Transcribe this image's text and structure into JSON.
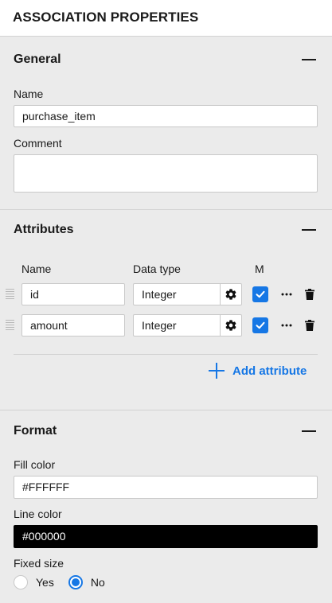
{
  "header": {
    "title": "ASSOCIATION PROPERTIES"
  },
  "general": {
    "title": "General",
    "name_label": "Name",
    "name_value": "purchase_item",
    "comment_label": "Comment",
    "comment_value": ""
  },
  "attributes": {
    "title": "Attributes",
    "columns": {
      "name": "Name",
      "data_type": "Data type",
      "mandatory": "M"
    },
    "rows": [
      {
        "name": "id",
        "data_type": "Integer",
        "mandatory": true
      },
      {
        "name": "amount",
        "data_type": "Integer",
        "mandatory": true
      }
    ],
    "add_label": "Add attribute"
  },
  "format": {
    "title": "Format",
    "fill_label": "Fill color",
    "fill_value": "#FFFFFF",
    "line_label": "Line color",
    "line_value": "#000000",
    "fixed_size_label": "Fixed size",
    "options": [
      "Yes",
      "No"
    ],
    "selected": "No"
  },
  "colors": {
    "accent": "#1677e5",
    "panel_bg": "#ebebeb",
    "header_bg": "#ffffff"
  },
  "icons": [
    "minus-icon",
    "gear-icon",
    "check-icon",
    "ellipsis-icon",
    "trash-icon",
    "plus-icon",
    "drag-handle-icon"
  ]
}
